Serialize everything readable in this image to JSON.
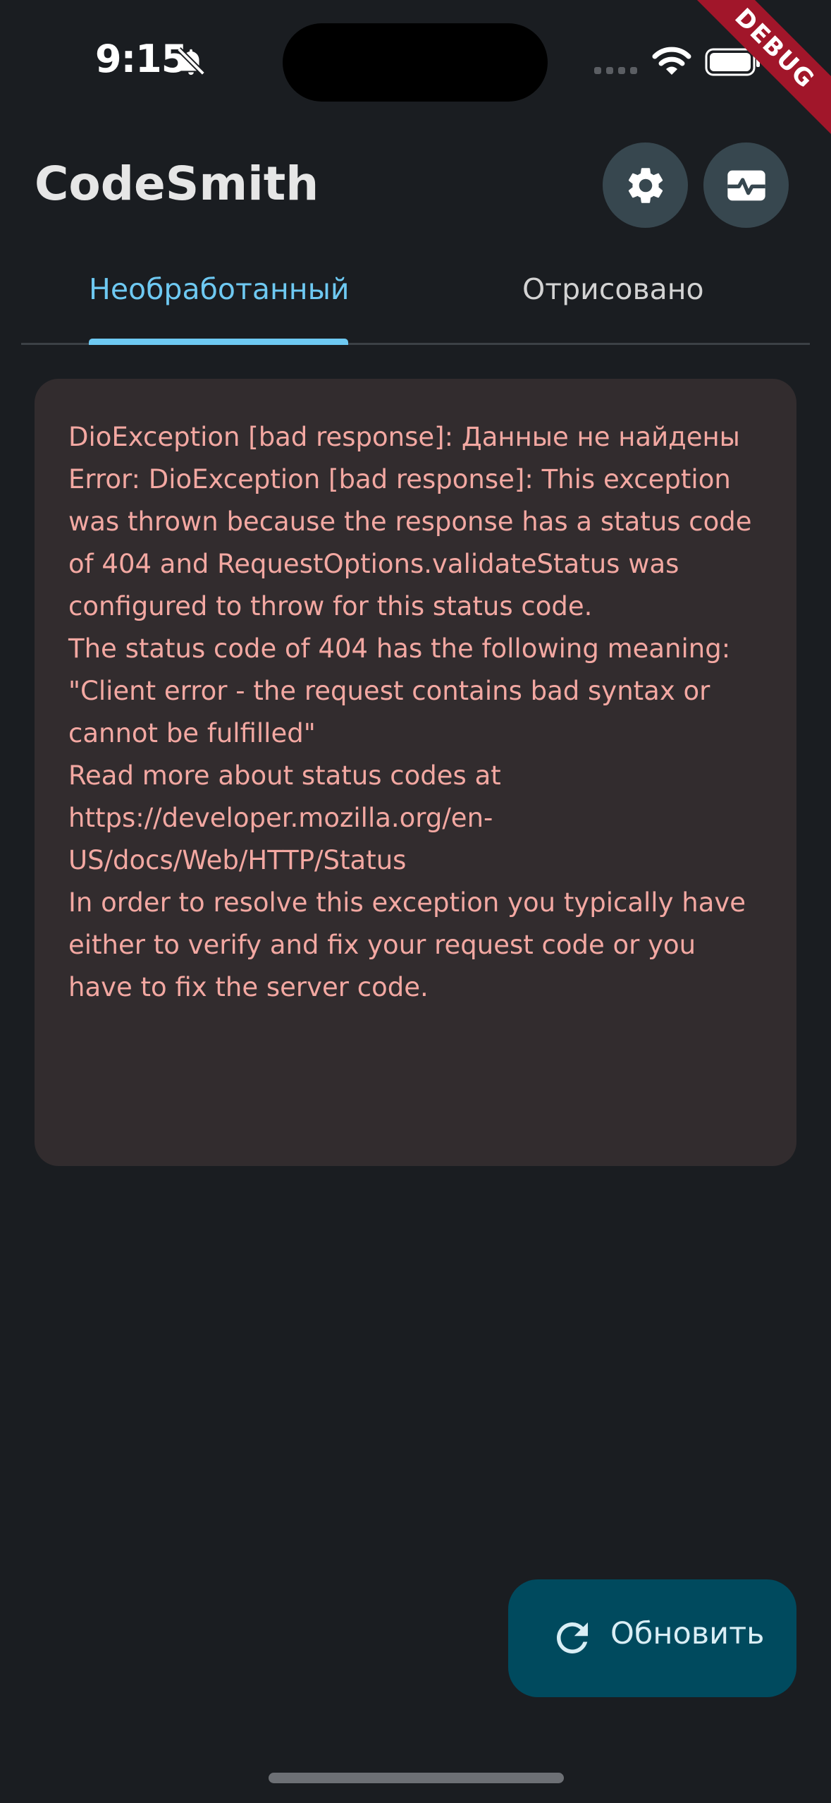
{
  "status_bar": {
    "time": "9:15",
    "bell_icon": "bell-off-icon",
    "signal_icon": "cellular-signal-icon",
    "wifi_icon": "wifi-icon",
    "battery_icon": "battery-icon"
  },
  "debug_banner": {
    "label": "DEBUG",
    "color": "#a1162a"
  },
  "app_bar": {
    "title": "CodeSmith",
    "actions": [
      {
        "icon": "gear-icon"
      },
      {
        "icon": "monitor-heart-icon"
      }
    ]
  },
  "tabs": [
    {
      "label": "Необработанный",
      "selected": true
    },
    {
      "label": "Отрисовано",
      "selected": false
    }
  ],
  "error_card": {
    "text": "DioException [bad response]: Данные не найдены\nError: DioException [bad response]: This exception was thrown because the response has a status code of 404 and RequestOptions.validateStatus was configured to throw for this status code.\nThe status code of 404 has the following meaning: \"Client error - the request contains bad syntax or cannot be fulfilled\"\nRead more about status codes at https://developer.mozilla.org/en-US/docs/Web/HTTP/Status\nIn order to resolve this exception you typically have either to verify and fix your request code or you have to fix the server code."
  },
  "refresh_button": {
    "label": "Обновить",
    "icon": "refresh-icon"
  },
  "colors": {
    "background": "#1a1d21",
    "accent": "#6ec9f2",
    "error_text": "#f3a8a2",
    "card": "#322c2e",
    "fab": "#004a5e"
  }
}
